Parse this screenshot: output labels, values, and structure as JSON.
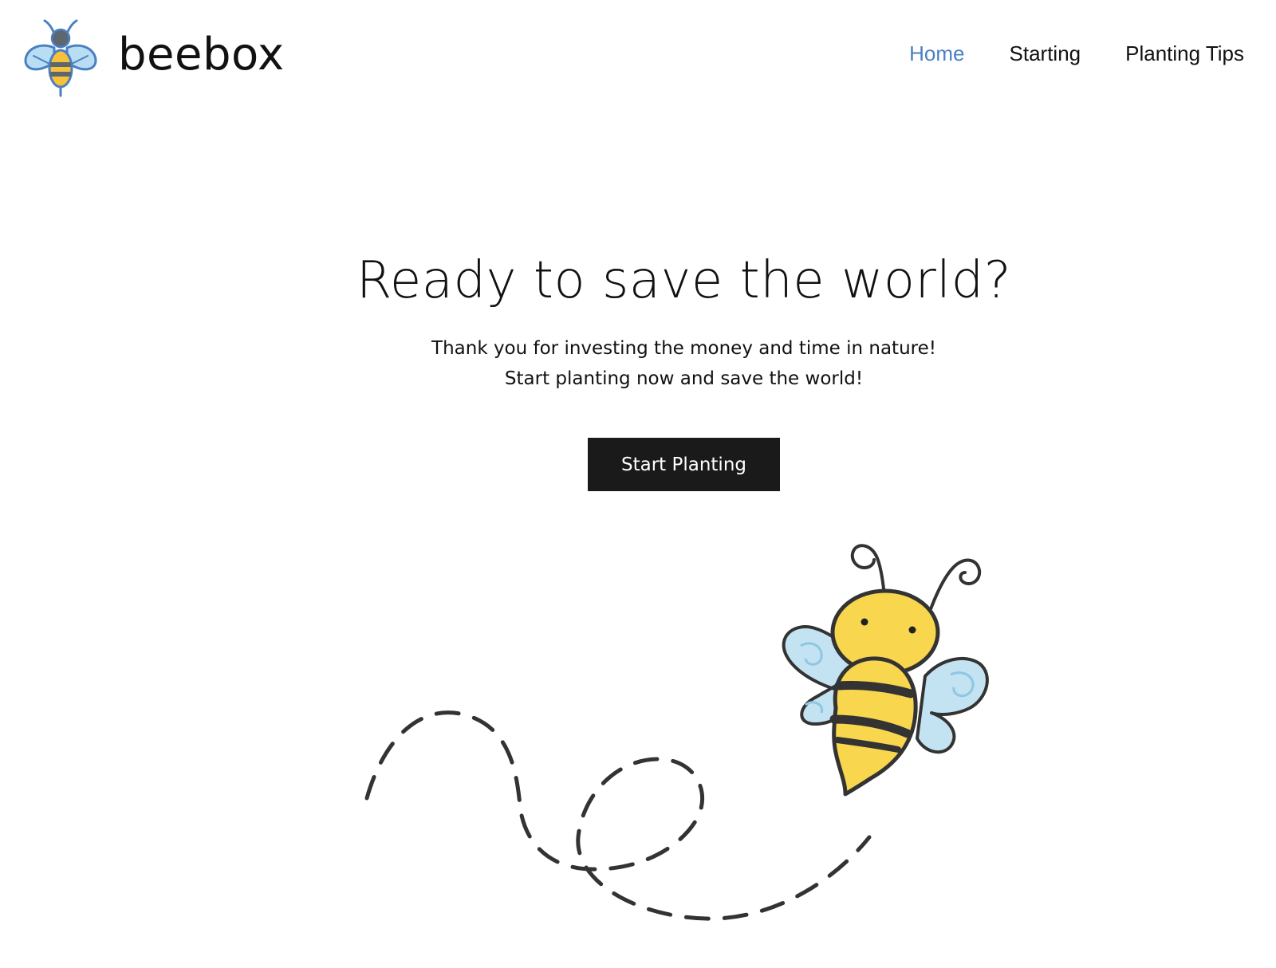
{
  "header": {
    "brand": "beebox",
    "logo_icon": "bee-logo-icon",
    "nav": [
      {
        "label": "Home",
        "active": true
      },
      {
        "label": "Starting",
        "active": false
      },
      {
        "label": "Planting Tips",
        "active": false
      }
    ]
  },
  "hero": {
    "title": "Ready to save the world?",
    "subtitle_lines": [
      "Thank you for investing the money and time in nature!",
      "Start planting now and save the world!"
    ],
    "cta_label": "Start Planting",
    "illustration_icon": "bee-flight-illustration"
  },
  "colors": {
    "accent": "#4a80c2",
    "button_bg": "#1a1a1a",
    "bee_yellow": "#f8d64e",
    "wing_blue": "#bfe0f0",
    "outline": "#333333"
  }
}
